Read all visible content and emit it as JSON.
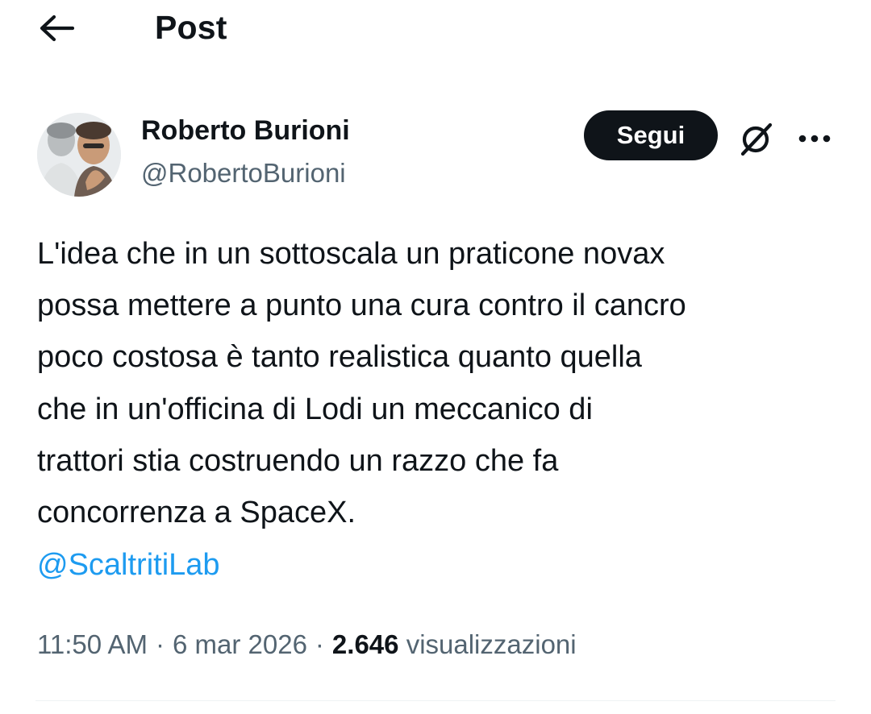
{
  "header": {
    "title": "Post",
    "back_icon": "arrow-left-icon"
  },
  "author": {
    "display_name": "Roberto Burioni",
    "handle": "@RobertoBurioni",
    "avatar": "avatar-photo"
  },
  "actions": {
    "follow_label": "Segui",
    "grok_icon": "grok-slash-icon",
    "more_icon": "more-dots-icon"
  },
  "tweet": {
    "lines": [
      "L'idea che in un sottoscala un praticone novax",
      "possa mettere a punto una cura contro il cancro",
      "poco costosa è tanto realistica quanto quella",
      "che in un'officina di Lodi un meccanico di",
      "trattori stia costruendo un razzo che fa",
      "concorrenza a SpaceX."
    ],
    "mention": "@ScaltritiLab"
  },
  "meta": {
    "time": "11:50 AM",
    "separator": "·",
    "date": "6 mar 2026",
    "views_count": "2.646",
    "views_label": "visualizzazioni"
  },
  "colors": {
    "text": "#0f1419",
    "secondary": "#536471",
    "link": "#1d9bf0",
    "button_bg": "#0f1419"
  }
}
